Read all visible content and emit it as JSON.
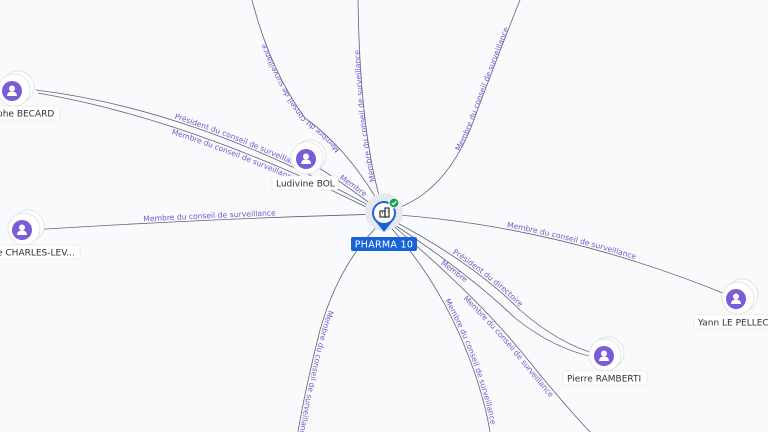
{
  "company": {
    "name": "PHARMA 10",
    "icon": "building-icon",
    "status_icon": "check-badge-icon",
    "brand_color": "#1764d8",
    "status_color": "#1e9e5a"
  },
  "people": [
    {
      "id": "becard",
      "name": "phe BECARD"
    },
    {
      "id": "charles",
      "name": "e CHARLES-LEV..."
    },
    {
      "id": "bol",
      "name": "Ludivine BOL"
    },
    {
      "id": "pellec",
      "name": "Yann LE PELLEC"
    },
    {
      "id": "ramberti",
      "name": "Pierre RAMBERTI"
    }
  ],
  "relations": [
    {
      "id": "top-left",
      "label": "Membre du conseil de surveillance"
    },
    {
      "id": "top-center",
      "label": "Membre du conseil de surveillance"
    },
    {
      "id": "top-right",
      "label": "Membre du conseil de surveillance"
    },
    {
      "id": "becard-1",
      "label": "Président du conseil de surveillance"
    },
    {
      "id": "becard-2",
      "label": "Membre du conseil de surveillance"
    },
    {
      "id": "bol",
      "label": "Membre"
    },
    {
      "id": "charles",
      "label": "Membre du conseil de surveillance"
    },
    {
      "id": "pellec",
      "label": "Membre du conseil de surveillance"
    },
    {
      "id": "ramberti-1",
      "label": "Président du directoire"
    },
    {
      "id": "ramberti-2",
      "label": "Membre"
    },
    {
      "id": "bottom-right-a",
      "label": "Membre du conseil de surveillance"
    },
    {
      "id": "bottom-center",
      "label": "Membre du conseil de surveillance"
    },
    {
      "id": "bottom-left",
      "label": "Membre du conseil de surveillance"
    }
  ]
}
